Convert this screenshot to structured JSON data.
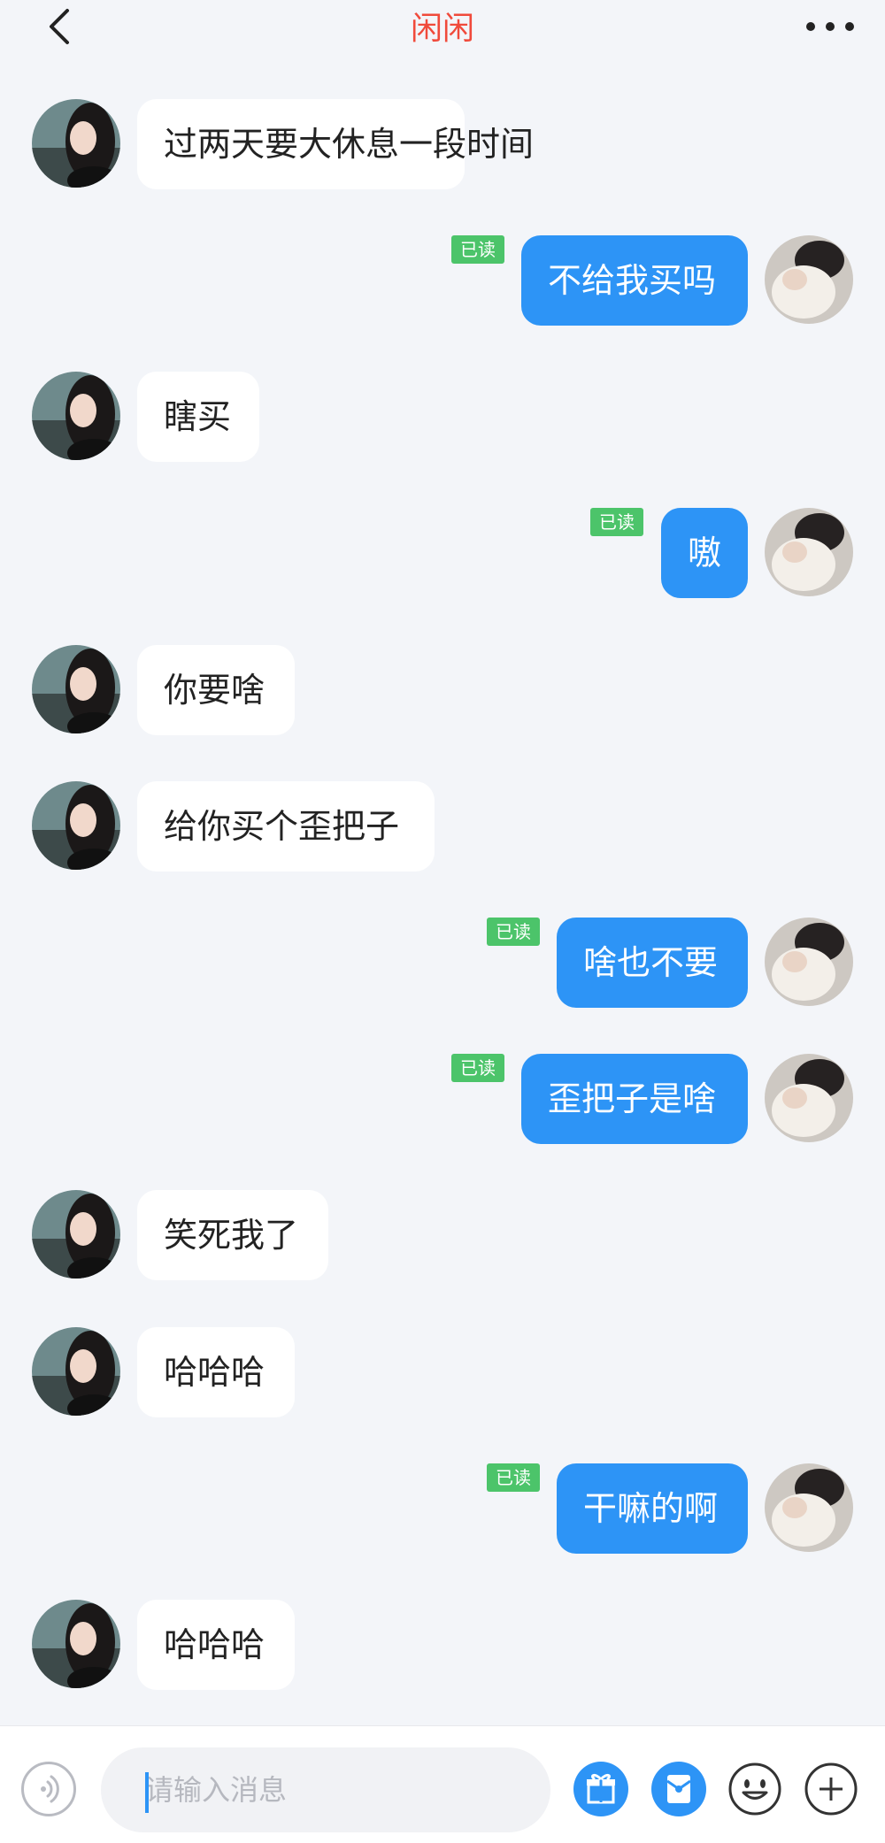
{
  "header": {
    "title": "闲闲"
  },
  "colors": {
    "title": "#f04a3b",
    "sent_bubble": "#2d94f6",
    "read_badge": "#4cc46a",
    "background": "#f3f5f9"
  },
  "messages": [
    {
      "side": "left",
      "text": "过两天要大休息一段时间"
    },
    {
      "side": "right",
      "text": "不给我买吗",
      "status": "已读"
    },
    {
      "side": "left",
      "text": "瞎买"
    },
    {
      "side": "right",
      "text": "嗷",
      "status": "已读"
    },
    {
      "side": "left",
      "text": "你要啥"
    },
    {
      "side": "left",
      "text": "给你买个歪把子"
    },
    {
      "side": "right",
      "text": "啥也不要",
      "status": "已读"
    },
    {
      "side": "right",
      "text": "歪把子是啥",
      "status": "已读"
    },
    {
      "side": "left",
      "text": "笑死我了"
    },
    {
      "side": "left",
      "text": "哈哈哈"
    },
    {
      "side": "right",
      "text": "干嘛的啊",
      "status": "已读"
    },
    {
      "side": "left",
      "text": "哈哈哈"
    }
  ],
  "input": {
    "placeholder": "请输入消息"
  },
  "icons": {
    "back": "chevron-left-icon",
    "more": "more-dots-icon",
    "voice": "voice-icon",
    "gift": "gift-icon",
    "red_packet": "red-packet-icon",
    "emoji": "emoji-icon",
    "add": "plus-icon"
  }
}
